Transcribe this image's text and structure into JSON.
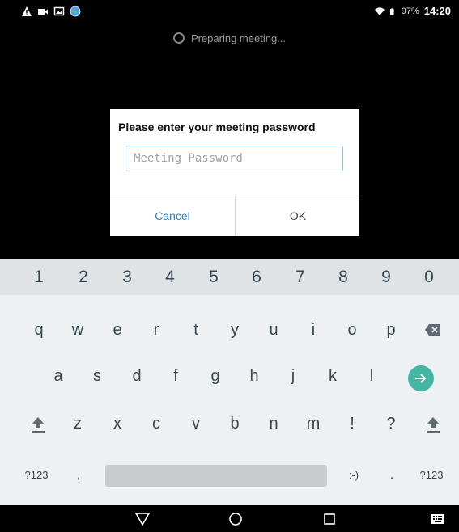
{
  "status_bar": {
    "icons_left": [
      "warning-icon",
      "video-camera-icon",
      "image-icon",
      "globe-icon"
    ],
    "icons_right": [
      "wifi-icon",
      "battery-icon"
    ],
    "battery_pct": "97%",
    "time": "14:20"
  },
  "meeting": {
    "status_text": "Preparing meeting..."
  },
  "dialog": {
    "title": "Please enter your meeting password",
    "input_value": "",
    "input_placeholder": "Meeting Password",
    "cancel_label": "Cancel",
    "ok_label": "OK",
    "cancel_color": "#2d82d3"
  },
  "keyboard": {
    "number_row": [
      "1",
      "2",
      "3",
      "4",
      "5",
      "6",
      "7",
      "8",
      "9",
      "0"
    ],
    "row_q": [
      "q",
      "w",
      "e",
      "r",
      "t",
      "y",
      "u",
      "i",
      "o",
      "p"
    ],
    "row_a": [
      "a",
      "s",
      "d",
      "f",
      "g",
      "h",
      "j",
      "k",
      "l"
    ],
    "row_z": [
      "z",
      "x",
      "c",
      "v",
      "b",
      "n",
      "m",
      "!",
      "?"
    ],
    "symbols_label_left": "?123",
    "comma": ",",
    "emoticon": ":-)",
    "period": ".",
    "symbols_label_right": "?123",
    "enter_color": "#45b6a3",
    "icons": [
      "backspace-icon",
      "enter-icon",
      "shift-icon"
    ]
  },
  "nav_bar": {
    "icons": [
      "back-icon",
      "home-icon",
      "recents-icon",
      "keyboard-icon"
    ]
  }
}
